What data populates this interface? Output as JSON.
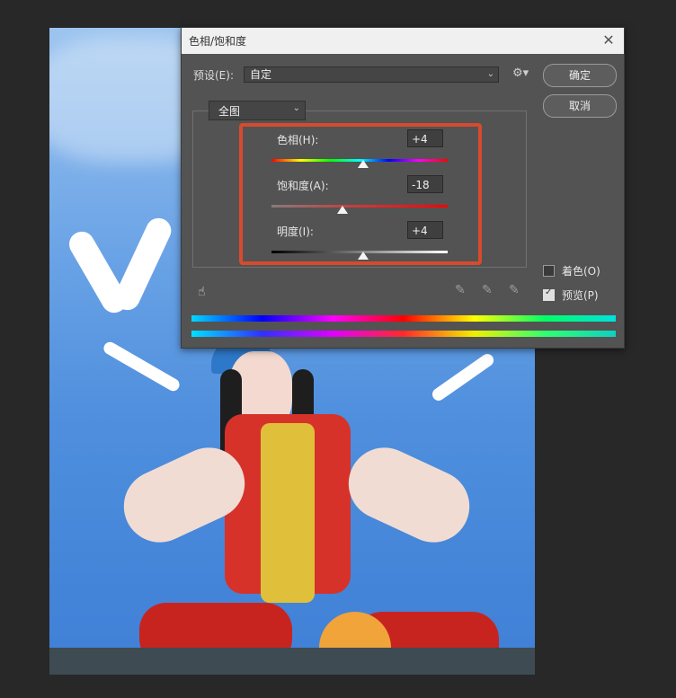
{
  "dialog": {
    "title": "色相/饱和度",
    "preset_label": "预设(E):",
    "preset_value": "自定",
    "channel_value": "全图",
    "ok_label": "确定",
    "cancel_label": "取消",
    "colorize_label": "着色(O)",
    "preview_label": "预览(P)",
    "colorize_checked": false,
    "preview_checked": true
  },
  "sliders": {
    "hue": {
      "label": "色相(H):",
      "value": "+4"
    },
    "saturation": {
      "label": "饱和度(A):",
      "value": "-18"
    },
    "lightness": {
      "label": "明度(I):",
      "value": "+4"
    }
  },
  "icons": {
    "close": "close-icon",
    "gear": "gear-icon",
    "hand": "hand-adjust-icon",
    "droppers": [
      "eyedropper-icon",
      "eyedropper-add-icon",
      "eyedropper-subtract-icon"
    ]
  },
  "colors": {
    "highlight": "#d84a2e",
    "dialog_bg": "#535353",
    "app_bg": "#282828"
  }
}
